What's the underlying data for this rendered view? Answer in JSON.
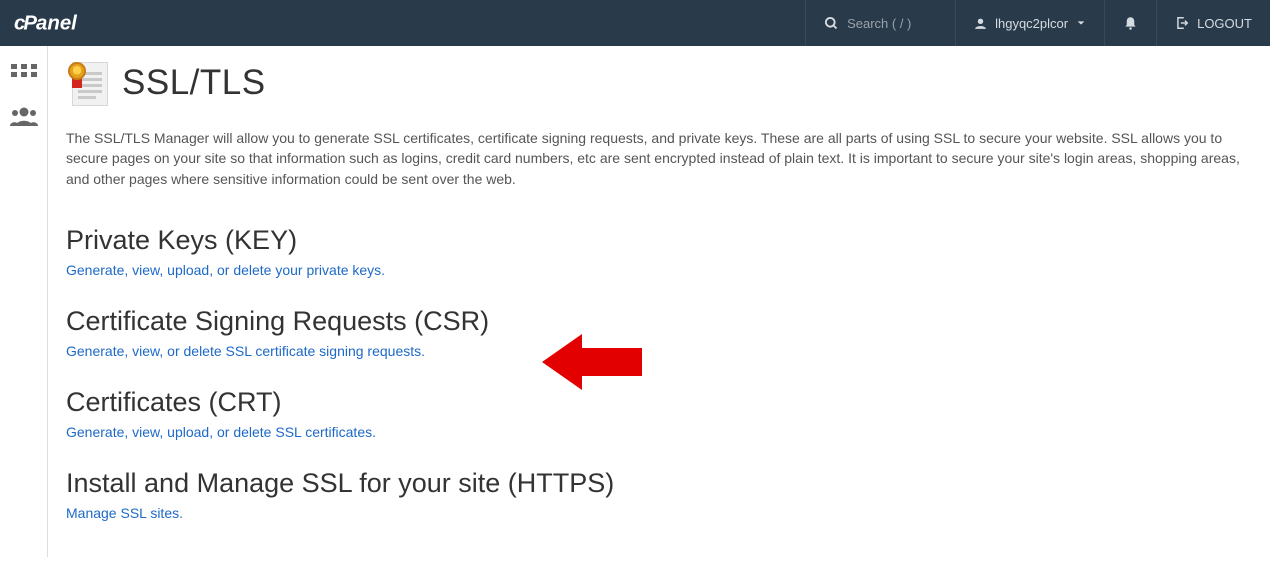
{
  "header": {
    "search_placeholder": "Search ( / )",
    "username": "lhgyqc2plcor",
    "logout_label": "LOGOUT"
  },
  "page": {
    "title": "SSL/TLS",
    "intro": "The SSL/TLS Manager will allow you to generate SSL certificates, certificate signing requests, and private keys. These are all parts of using SSL to secure your website. SSL allows you to secure pages on your site so that information such as logins, credit card numbers, etc are sent encrypted instead of plain text. It is important to secure your site's login areas, shopping areas, and other pages where sensitive information could be sent over the web."
  },
  "sections": {
    "private_keys": {
      "title": "Private Keys (KEY)",
      "link": "Generate, view, upload, or delete your private keys."
    },
    "csr": {
      "title": "Certificate Signing Requests (CSR)",
      "link": "Generate, view, or delete SSL certificate signing requests."
    },
    "crt": {
      "title": "Certificates (CRT)",
      "link": "Generate, view, upload, or delete SSL certificates."
    },
    "install": {
      "title": "Install and Manage SSL for your site (HTTPS)",
      "link": "Manage SSL sites."
    }
  }
}
